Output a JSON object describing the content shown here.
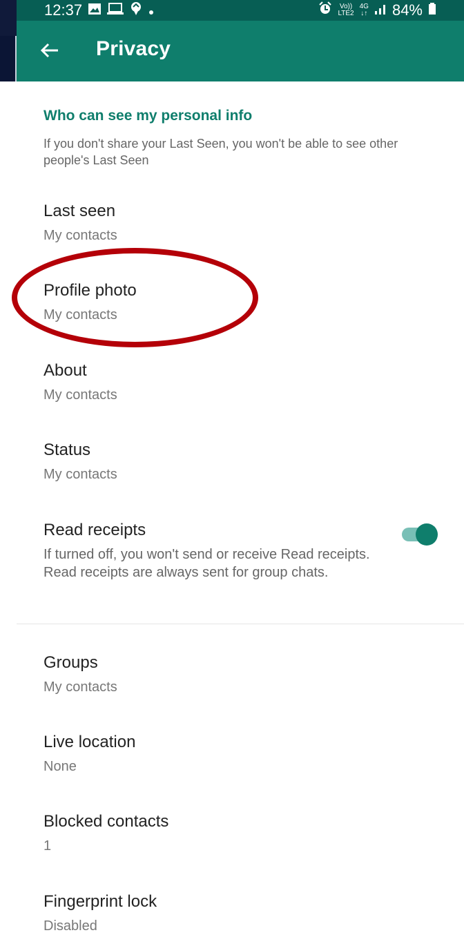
{
  "status_bar": {
    "time": "12:37",
    "left_icons": [
      "photo-icon",
      "laptop-icon",
      "app-icon",
      "dot-icon"
    ],
    "right_icons": [
      "alarm-icon",
      "volte-icon",
      "4g-icon",
      "signal-icon",
      "battery-icon"
    ],
    "volte_top": "Vo))",
    "volte_bottom": "LTE2",
    "network": "4G",
    "battery": "84%"
  },
  "appbar": {
    "title": "Privacy"
  },
  "section": {
    "title": "Who can see my personal info",
    "description": "If you don't share your Last Seen, you won't be able to see other people's Last Seen"
  },
  "items": [
    {
      "title": "Last seen",
      "subtitle": "My contacts"
    },
    {
      "title": "Profile photo",
      "subtitle": "My contacts"
    },
    {
      "title": "About",
      "subtitle": "My contacts"
    },
    {
      "title": "Status",
      "subtitle": "My contacts"
    },
    {
      "title": "Read receipts",
      "subtitle": "If turned off, you won't send or receive Read receipts. Read receipts are always sent for group chats.",
      "toggle": true
    },
    {
      "title": "Groups",
      "subtitle": "My contacts"
    },
    {
      "title": "Live location",
      "subtitle": "None"
    },
    {
      "title": "Blocked contacts",
      "subtitle": "1"
    },
    {
      "title": "Fingerprint lock",
      "subtitle": "Disabled"
    }
  ],
  "colors": {
    "status_bar": "#075e54",
    "app_bar": "#0f7e6c",
    "accent": "#0f7e6c",
    "highlight": "#b40008"
  }
}
